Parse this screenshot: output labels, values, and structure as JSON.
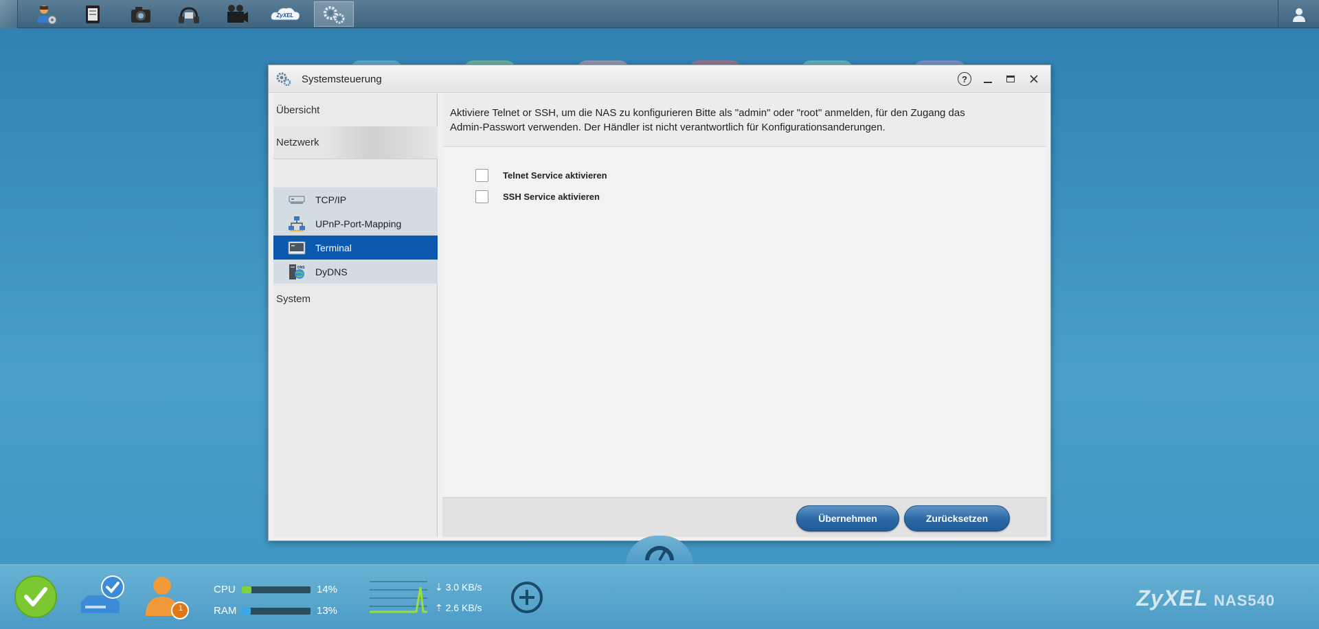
{
  "taskbar": {
    "apps": [
      {
        "name": "user-settings-icon"
      },
      {
        "name": "file-browser-icon"
      },
      {
        "name": "photo-icon"
      },
      {
        "name": "music-icon"
      },
      {
        "name": "video-icon"
      },
      {
        "name": "zyxel-cloud-icon",
        "label": "ZyXEL"
      },
      {
        "name": "control-panel-icon",
        "active": true
      }
    ]
  },
  "window": {
    "title": "Systemsteuerung",
    "help_symbol": "?",
    "minimize_symbol": "–",
    "maximize_symbol": "□",
    "close_symbol": "✕"
  },
  "sidebar": {
    "overview": "Übersicht",
    "network": "Netzwerk",
    "system": "System",
    "items": [
      {
        "label": "TCP/IP",
        "icon": "network-card-icon"
      },
      {
        "label": "UPnP-Port-Mapping",
        "icon": "upnp-icon"
      },
      {
        "label": "Terminal",
        "icon": "terminal-icon",
        "selected": true
      },
      {
        "label": "DyDNS",
        "icon": "dns-icon"
      }
    ]
  },
  "content": {
    "info_line1": "Aktiviere Telnet or SSH, um die NAS zu konfigurieren Bitte als \"admin\" oder \"root\" anmelden, für den Zugang das",
    "info_line2": "Admin-Passwort verwenden. Der Händler ist nicht verantwortlich für Konfigurationsanderungen.",
    "telnet_label": "Telnet Service aktivieren",
    "telnet_checked": false,
    "ssh_label": "SSH Service aktivieren",
    "ssh_checked": false,
    "apply_button": "Übernehmen",
    "reset_button": "Zurücksetzen"
  },
  "statusbar": {
    "cpu_label": "CPU",
    "cpu_percent": "14%",
    "cpu_value": 0.14,
    "ram_label": "RAM",
    "ram_percent": "13%",
    "ram_value": 0.13,
    "download": "3.0 KB/s",
    "upload": "2.6 KB/s",
    "notification_count": "1",
    "brand": "ZyXEL",
    "model": "NAS540"
  },
  "colors": {
    "selected": "#0a58b0",
    "button": "#2e6aa6",
    "cpu_fill": "#7fd23a",
    "ram_fill": "#3aa8e8"
  }
}
